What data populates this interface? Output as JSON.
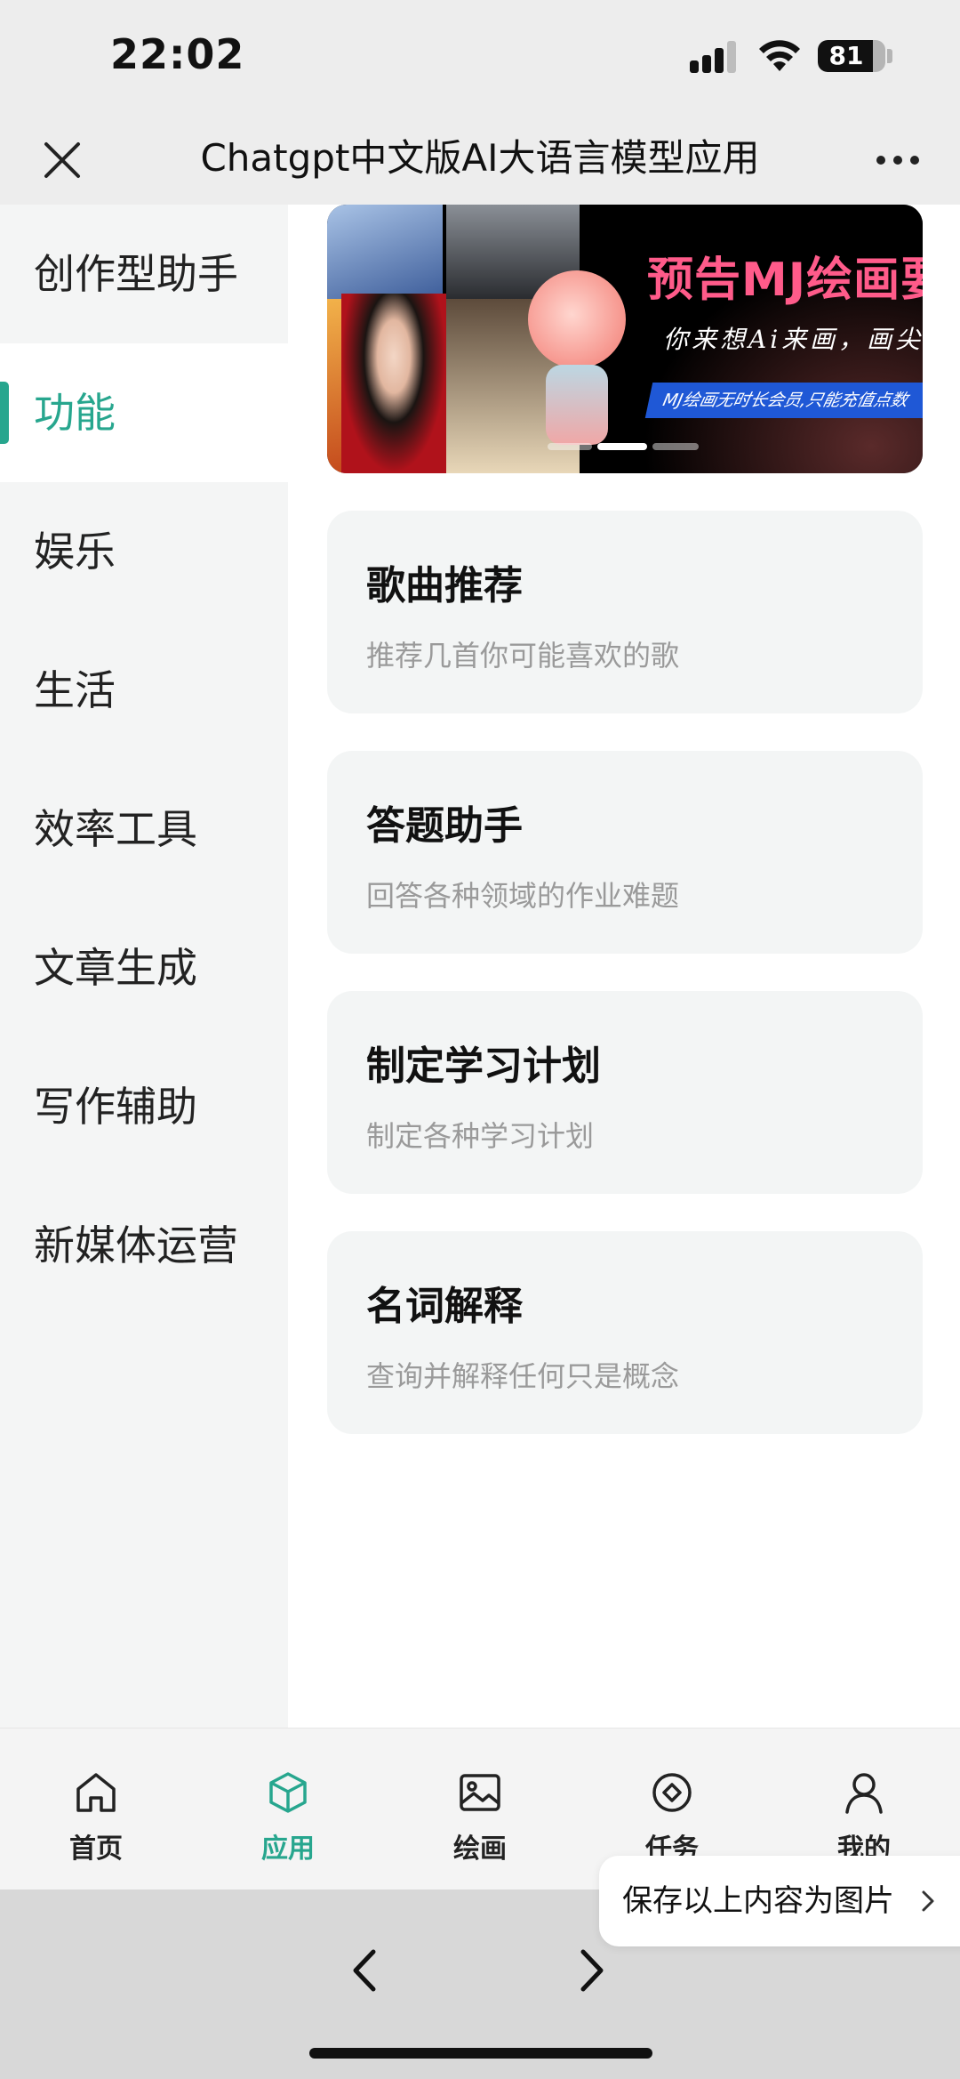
{
  "status_bar": {
    "time": "22:02",
    "battery": "81",
    "battery_level": 0.81
  },
  "nav": {
    "title": "Chatgpt中文版AI大语言模型应用",
    "close_icon": "close-icon",
    "more_icon": "more-icon"
  },
  "sidebar": {
    "items": [
      {
        "label": "创作型助手"
      },
      {
        "label": "功能"
      },
      {
        "label": "娱乐"
      },
      {
        "label": "生活"
      },
      {
        "label": "效率工具"
      },
      {
        "label": "文章生成"
      },
      {
        "label": "写作辅助"
      },
      {
        "label": "新媒体运营"
      }
    ],
    "active_index": 1
  },
  "banner": {
    "headline": "预告MJ绘画要",
    "subtitle": "你来想Ai来画，画尖位",
    "tag": "MJ绘画无时长会员,只能充值点数",
    "slide_count": 3,
    "active_slide": 1
  },
  "cards": [
    {
      "title": "歌曲推荐",
      "desc": "推荐几首你可能喜欢的歌"
    },
    {
      "title": "答题助手",
      "desc": "回答各种领域的作业难题"
    },
    {
      "title": "制定学习计划",
      "desc": "制定各种学习计划"
    },
    {
      "title": "名词解释",
      "desc": "查询并解释任何只是概念"
    }
  ],
  "tabs": [
    {
      "label": "首页",
      "icon": "home-icon"
    },
    {
      "label": "应用",
      "icon": "cube-icon"
    },
    {
      "label": "绘画",
      "icon": "image-icon"
    },
    {
      "label": "任务",
      "icon": "target-icon"
    },
    {
      "label": "我的",
      "icon": "user-icon"
    }
  ],
  "active_tab": 1,
  "save_prompt": {
    "label": "保存以上内容为图片"
  },
  "colors": {
    "accent": "#27a68e",
    "card_bg": "#f3f5f5",
    "sidebar_bg": "#f4f5f5",
    "chrome_bg": "#ededed"
  }
}
